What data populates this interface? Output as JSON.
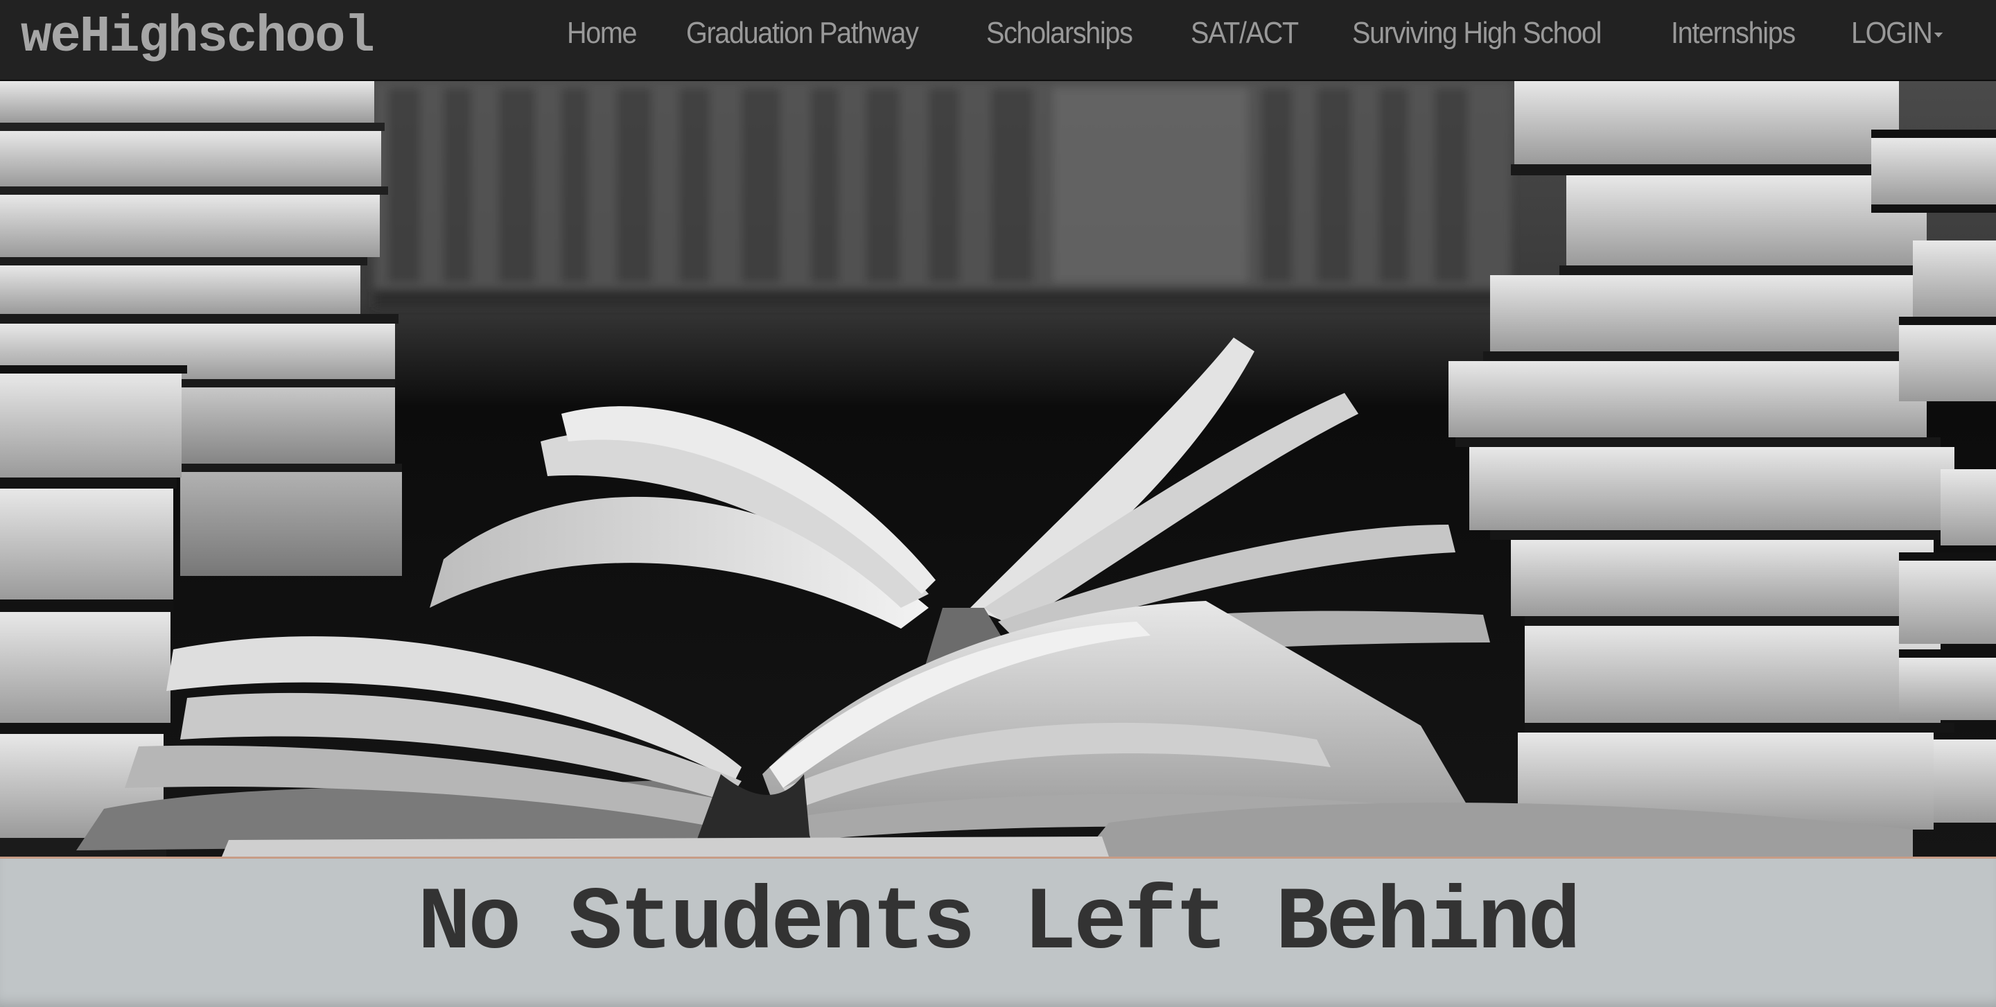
{
  "brand": "weHighschool",
  "nav": {
    "items": [
      {
        "label": "Home"
      },
      {
        "label": "Graduation Pathway"
      },
      {
        "label": "Scholarships"
      },
      {
        "label": "SAT/ACT"
      },
      {
        "label": "Surviving High School"
      },
      {
        "label": "Internships"
      }
    ],
    "login_label": "LOGIN"
  },
  "hero": {
    "image": "open-books-photo"
  },
  "banner": {
    "tagline": "No Students Left Behind"
  },
  "colors": {
    "navbar_bg": "#222222",
    "nav_text": "#999999",
    "banner_bg": "#c0c5c7",
    "tagline_text": "#333333",
    "banner_accent": "#c79c86"
  }
}
